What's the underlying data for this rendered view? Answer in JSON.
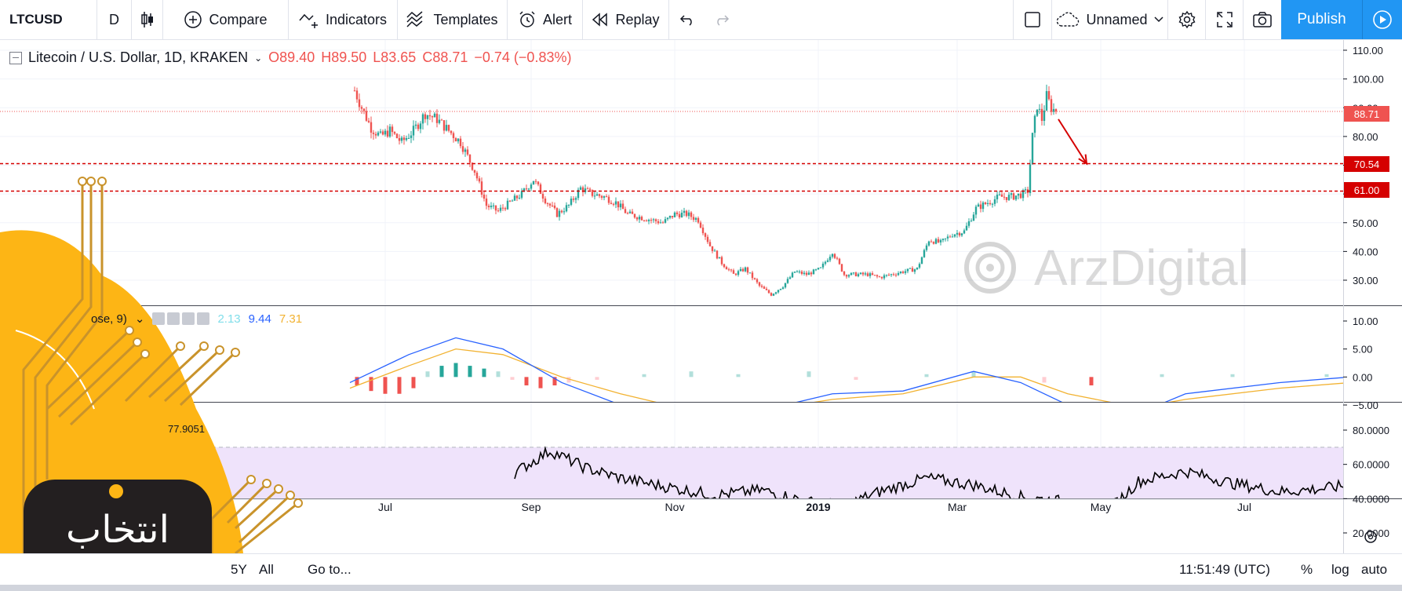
{
  "toolbar": {
    "symbol": "LTCUSD",
    "interval": "D",
    "compare": "Compare",
    "indicators": "Indicators",
    "templates": "Templates",
    "alert": "Alert",
    "replay": "Replay",
    "layout_name": "Unnamed",
    "publish": "Publish"
  },
  "legend": {
    "title": "Litecoin / U.S. Dollar, 1D, KRAKEN",
    "open": "O89.40",
    "high": "H89.50",
    "low": "L83.65",
    "close": "C88.71",
    "change": "−0.74 (−0.83%)",
    "macd_title": "ose, 9)",
    "macd_hist_value": "2.13",
    "macd_value": "9.44",
    "macd_signal_value": "7.31",
    "rsi_value": "77.9051"
  },
  "price_labels": {
    "last": "88.71",
    "level_1": "70.54",
    "level_2": "61.00"
  },
  "bottom_bar": {
    "range_5y": "5Y",
    "range_all": "All",
    "goto": "Go to...",
    "time": "11:51:49 (UTC)",
    "percent": "%",
    "log": "log",
    "auto": "auto"
  },
  "watermark": {
    "text": "ArzDigital",
    "logo_text": "انتخاب"
  },
  "colors": {
    "up": "#26a69a",
    "down": "#ef5350",
    "macd_line": "#2962ff",
    "signal_line": "#f2b231",
    "hist_up_strong": "#26a69a",
    "hist_up_weak": "#b2dfdb",
    "hist_down_strong": "#ef5350",
    "hist_down_weak": "#ffcdd2",
    "rsi_band": "#efe3fb",
    "level_line": "#d50000",
    "accent": "#2196f3",
    "brand_orange": "#fdb515"
  },
  "chart_data": [
    {
      "type": "candlestick",
      "title": "Litecoin / U.S. Dollar, 1D, KRAKEN",
      "x_tick_labels": [
        "Jul",
        "Sep",
        "Nov",
        "2019",
        "Mar",
        "May",
        "Jul"
      ],
      "x_tick_dates": [
        "2018-07-01",
        "2018-09-01",
        "2018-11-01",
        "2019-01-01",
        "2019-03-01",
        "2019-05-01",
        "2019-07-01"
      ],
      "y_ticks": [
        110,
        100,
        90,
        80,
        70,
        60,
        50,
        40,
        30
      ],
      "y_tick_labels": [
        "110.00",
        "100.00",
        "90.00",
        "80.00",
        "70.00",
        "60.00",
        "50.00",
        "40.00",
        "30.00"
      ],
      "ylim": [
        20,
        113
      ],
      "last_price": 88.71,
      "horizontal_levels": [
        70.54,
        61.0
      ],
      "close_path": [
        [
          "2018-06-18",
          96
        ],
        [
          "2018-06-21",
          90
        ],
        [
          "2018-06-25",
          83
        ],
        [
          "2018-06-29",
          80
        ],
        [
          "2018-07-03",
          82
        ],
        [
          "2018-07-08",
          78
        ],
        [
          "2018-07-13",
          82
        ],
        [
          "2018-07-18",
          88
        ],
        [
          "2018-07-23",
          86
        ],
        [
          "2018-07-28",
          82
        ],
        [
          "2018-08-02",
          78
        ],
        [
          "2018-08-08",
          68
        ],
        [
          "2018-08-13",
          56
        ],
        [
          "2018-08-18",
          54
        ],
        [
          "2018-08-23",
          57
        ],
        [
          "2018-08-28",
          60
        ],
        [
          "2018-09-02",
          65
        ],
        [
          "2018-09-07",
          58
        ],
        [
          "2018-09-12",
          53
        ],
        [
          "2018-09-17",
          56
        ],
        [
          "2018-09-22",
          62
        ],
        [
          "2018-09-27",
          60
        ],
        [
          "2018-10-02",
          59
        ],
        [
          "2018-10-07",
          57
        ],
        [
          "2018-10-12",
          53
        ],
        [
          "2018-10-17",
          52
        ],
        [
          "2018-10-22",
          51
        ],
        [
          "2018-10-27",
          50
        ],
        [
          "2018-11-01",
          53
        ],
        [
          "2018-11-06",
          53
        ],
        [
          "2018-11-11",
          51
        ],
        [
          "2018-11-16",
          42
        ],
        [
          "2018-11-21",
          36
        ],
        [
          "2018-11-26",
          32
        ],
        [
          "2018-12-01",
          34
        ],
        [
          "2018-12-07",
          28
        ],
        [
          "2018-12-12",
          25
        ],
        [
          "2018-12-17",
          28
        ],
        [
          "2018-12-22",
          33
        ],
        [
          "2018-12-27",
          32
        ],
        [
          "2019-01-02",
          34
        ],
        [
          "2019-01-07",
          40
        ],
        [
          "2019-01-12",
          32
        ],
        [
          "2019-01-17",
          32
        ],
        [
          "2019-01-22",
          32
        ],
        [
          "2019-01-27",
          31
        ],
        [
          "2019-02-01",
          32
        ],
        [
          "2019-02-06",
          33
        ],
        [
          "2019-02-12",
          34
        ],
        [
          "2019-02-17",
          44
        ],
        [
          "2019-02-22",
          43
        ],
        [
          "2019-02-27",
          46
        ],
        [
          "2019-03-04",
          47
        ],
        [
          "2019-03-09",
          55
        ],
        [
          "2019-03-14",
          57
        ],
        [
          "2019-03-19",
          59
        ],
        [
          "2019-03-24",
          59
        ],
        [
          "2019-03-29",
          60
        ],
        [
          "2019-03-31",
          61
        ],
        [
          "2019-04-02",
          80
        ],
        [
          "2019-04-04",
          91
        ],
        [
          "2019-04-06",
          86
        ],
        [
          "2019-04-08",
          94
        ],
        [
          "2019-04-10",
          90
        ],
        [
          "2019-04-12",
          88.71
        ]
      ],
      "annotation_arrow": {
        "from": [
          "2019-04-13",
          86
        ],
        "to": [
          "2019-04-25",
          70.54
        ]
      }
    },
    {
      "type": "line+bar",
      "title": "MACD",
      "y_ticks": [
        10,
        5,
        0,
        -5
      ],
      "y_tick_labels": [
        "10.00",
        "5.00",
        "0.00",
        "−5.00"
      ],
      "ylim": [
        -6,
        10.5
      ],
      "series": [
        {
          "name": "macd",
          "values": [
            [
              -15,
              -1
            ],
            [
              10,
              4
            ],
            [
              30,
              7
            ],
            [
              50,
              5
            ],
            [
              75,
              -1
            ],
            [
              100,
              -5
            ],
            [
              130,
              -7
            ],
            [
              160,
              -6
            ],
            [
              190,
              -3
            ],
            [
              220,
              -2.5
            ],
            [
              250,
              1
            ],
            [
              270,
              -1
            ],
            [
              290,
              -5
            ],
            [
              320,
              -6.5
            ],
            [
              340,
              -3
            ],
            [
              380,
              -1
            ],
            [
              410,
              0
            ],
            [
              450,
              -1.5
            ],
            [
              490,
              -1
            ],
            [
              500,
              -2
            ],
            [
              525,
              -4
            ],
            [
              540,
              -6
            ],
            [
              560,
              -4
            ],
            [
              580,
              -2
            ],
            [
              600,
              1
            ],
            [
              615,
              0
            ],
            [
              645,
              -1
            ],
            [
              665,
              0.5
            ],
            [
              680,
              2
            ],
            [
              700,
              1.5
            ],
            [
              715,
              2
            ],
            [
              730,
              1
            ],
            [
              748,
              8
            ],
            [
              756,
              9.44
            ]
          ]
        },
        {
          "name": "signal",
          "values": [
            [
              -15,
              -2
            ],
            [
              10,
              2
            ],
            [
              30,
              5
            ],
            [
              50,
              4
            ],
            [
              75,
              0
            ],
            [
              100,
              -3
            ],
            [
              130,
              -6
            ],
            [
              160,
              -6
            ],
            [
              190,
              -4
            ],
            [
              220,
              -3
            ],
            [
              250,
              0
            ],
            [
              270,
              0
            ],
            [
              290,
              -3
            ],
            [
              320,
              -5.5
            ],
            [
              340,
              -4
            ],
            [
              380,
              -2
            ],
            [
              410,
              -1
            ],
            [
              450,
              -1.2
            ],
            [
              490,
              -1
            ],
            [
              500,
              -1.5
            ],
            [
              525,
              -3
            ],
            [
              540,
              -5
            ],
            [
              560,
              -4.5
            ],
            [
              580,
              -3
            ],
            [
              600,
              0
            ],
            [
              615,
              0
            ],
            [
              645,
              0
            ],
            [
              665,
              0
            ],
            [
              680,
              1.5
            ],
            [
              700,
              1
            ],
            [
              715,
              1.5
            ],
            [
              730,
              1.5
            ],
            [
              748,
              5
            ],
            [
              756,
              7.31
            ]
          ]
        },
        {
          "name": "histogram",
          "values": [
            [
              -12,
              -1.5
            ],
            [
              -6,
              -2.5
            ],
            [
              0,
              -3
            ],
            [
              6,
              -3
            ],
            [
              12,
              -2
            ],
            [
              18,
              1
            ],
            [
              24,
              2
            ],
            [
              30,
              2.5
            ],
            [
              36,
              2
            ],
            [
              42,
              1.5
            ],
            [
              48,
              1
            ],
            [
              54,
              -0.5
            ],
            [
              60,
              -1.5
            ],
            [
              66,
              -2
            ],
            [
              72,
              -1.5
            ],
            [
              78,
              -1
            ],
            [
              90,
              -0.5
            ],
            [
              110,
              0.5
            ],
            [
              130,
              1
            ],
            [
              150,
              0.5
            ],
            [
              180,
              1
            ],
            [
              200,
              -0.5
            ],
            [
              230,
              0.5
            ],
            [
              250,
              1
            ],
            [
              280,
              -1
            ],
            [
              300,
              -1.5
            ],
            [
              330,
              0.5
            ],
            [
              360,
              0.5
            ],
            [
              400,
              0.5
            ],
            [
              430,
              0.3
            ],
            [
              460,
              -0.3
            ],
            [
              480,
              0.2
            ],
            [
              510,
              -0.8
            ],
            [
              540,
              0.3
            ],
            [
              560,
              0.8
            ],
            [
              580,
              1
            ],
            [
              600,
              0.5
            ],
            [
              630,
              0.3
            ],
            [
              660,
              0.4
            ],
            [
              690,
              0.3
            ],
            [
              710,
              -0.3
            ],
            [
              730,
              -0.3
            ],
            [
              744,
              1.5
            ],
            [
              750,
              2.5
            ],
            [
              756,
              2.13
            ]
          ]
        }
      ]
    },
    {
      "type": "line",
      "title": "RSI",
      "y_ticks": [
        80,
        60,
        40,
        20
      ],
      "y_tick_labels": [
        "80.0000",
        "60.0000",
        "40.0000",
        "20.0000"
      ],
      "ylim": [
        13,
        88
      ],
      "band": [
        30,
        70
      ],
      "last_value": 77.9051,
      "series": [
        {
          "name": "rsi",
          "values": [
            [
              55,
              55
            ],
            [
              70,
              68
            ],
            [
              85,
              58
            ],
            [
              100,
              52
            ],
            [
              115,
              48
            ],
            [
              140,
              42
            ],
            [
              160,
              45
            ],
            [
              180,
              38
            ],
            [
              195,
              36
            ],
            [
              210,
              44
            ],
            [
              230,
              52
            ],
            [
              250,
              48
            ],
            [
              270,
              41
            ],
            [
              290,
              38
            ],
            [
              305,
              30
            ],
            [
              320,
              50
            ],
            [
              340,
              56
            ],
            [
              360,
              49
            ],
            [
              380,
              44
            ],
            [
              400,
              46
            ],
            [
              420,
              50
            ],
            [
              440,
              48
            ],
            [
              460,
              45
            ],
            [
              480,
              47
            ],
            [
              500,
              55
            ],
            [
              520,
              38
            ],
            [
              540,
              27
            ],
            [
              560,
              30
            ],
            [
              580,
              45
            ],
            [
              600,
              52
            ],
            [
              620,
              56
            ],
            [
              640,
              48
            ],
            [
              660,
              47
            ],
            [
              680,
              50
            ],
            [
              700,
              56
            ],
            [
              720,
              64
            ],
            [
              740,
              58
            ],
            [
              760,
              60
            ],
            [
              780,
              62
            ],
            [
              800,
              60
            ],
            [
              830,
              66
            ],
            [
              850,
              85
            ],
            [
              852,
              78
            ]
          ]
        }
      ]
    }
  ]
}
